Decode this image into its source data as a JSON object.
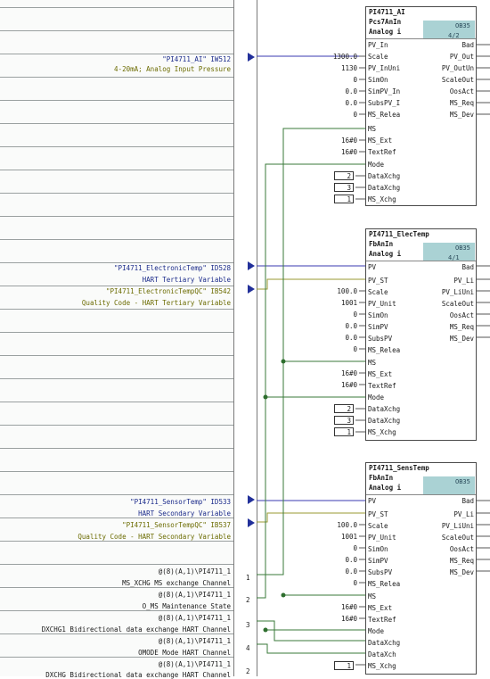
{
  "colors": {
    "blue_text": "#1a2a8a",
    "olive_text": "#6b6b00",
    "ob_fill": "#aad2d4",
    "wire_green": "#3a7a3a",
    "wire_olive": "#9a9a30",
    "wire_blue": "#3a3ab0"
  },
  "left_panel": {
    "params": [
      {
        "line1": "\"PI4711_AI\" IW512",
        "line2": "4-20mA; Analog Input Pressure",
        "c1": "blue",
        "c2": "olive"
      },
      {
        "line1": "\"PI4711_ElectronicTemp\" ID528",
        "line2": "HART Tertiary Variable",
        "c1": "blue",
        "c2": "blue"
      },
      {
        "line1": "\"PI4711_ElectronicTempQC\" IB542",
        "line2": "Quality Code - HART Tertiary Variable",
        "c1": "olive",
        "c2": "olive"
      },
      {
        "line1": "\"PI4711_SensorTemp\" ID533",
        "line2": "HART Secondary Variable",
        "c1": "blue",
        "c2": "blue"
      },
      {
        "line1": "\"PI4711_SensorTempQC\" IB537",
        "line2": "Quality Code - HART Secondary Variable",
        "c1": "olive",
        "c2": "olive"
      },
      {
        "line1": "@(8)(A,1)\\PI4711_1",
        "line2": "MS_XCHG MS exchange Channel",
        "c1": "blk",
        "c2": "blk"
      },
      {
        "line1": "@(8)(A,1)\\PI4711_1",
        "line2": "O_MS Maintenance State",
        "c1": "blk",
        "c2": "blk"
      },
      {
        "line1": "@(8)(A,1)\\PI4711_1",
        "line2": "DXCHG1 Bidirectional data exchange HART Channel",
        "c1": "blk",
        "c2": "blk"
      },
      {
        "line1": "@(8)(A,1)\\PI4711_1",
        "line2": "OMODE Mode HART Channel",
        "c1": "blk",
        "c2": "blk"
      },
      {
        "line1": "@(8)(A,1)\\PI4711_1",
        "line2": "DXCHG Bidirectional data exchange HART Channel",
        "c1": "blk",
        "c2": "blk"
      }
    ],
    "column_numbers": [
      "1",
      "2",
      "3",
      "4",
      "2"
    ]
  },
  "blocks": [
    {
      "name": "PI4711_AI",
      "type": "Pcs7AnIn",
      "sub": "Analog i",
      "ob": "OB35",
      "ob_frac": "4/2",
      "inputs": [
        {
          "pin": "PV_In",
          "val": ""
        },
        {
          "pin": "Scale",
          "val": "1300.0"
        },
        {
          "pin": "PV_InUni",
          "val": "1130"
        },
        {
          "pin": "SimOn",
          "val": "0"
        },
        {
          "pin": "SimPV_In",
          "val": "0.0"
        },
        {
          "pin": "SubsPV_I",
          "val": "0.0"
        },
        {
          "pin": "MS_Relea",
          "val": "0"
        },
        {
          "pin": "MS",
          "val": ""
        },
        {
          "pin": "MS_Ext",
          "val": "16#0"
        },
        {
          "pin": "TextRef",
          "val": "16#0"
        },
        {
          "pin": "Mode",
          "val": ""
        },
        {
          "pin": "DataXchg",
          "val": "2"
        },
        {
          "pin": "DataXchg",
          "val": "3"
        },
        {
          "pin": "MS_Xchg",
          "val": "1"
        }
      ],
      "outputs": [
        "Bad",
        "PV_Out",
        "PV_OutUn",
        "ScaleOut",
        "OosAct",
        "MS_Req",
        "MS_Dev"
      ]
    },
    {
      "name": "PI4711_ElecTemp",
      "type": "FbAnIn",
      "sub": "Analog i",
      "ob": "OB35",
      "ob_frac": "4/1",
      "inputs": [
        {
          "pin": "PV",
          "val": ""
        },
        {
          "pin": "PV_ST",
          "val": ""
        },
        {
          "pin": "Scale",
          "val": "100.0"
        },
        {
          "pin": "PV_Unit",
          "val": "1001"
        },
        {
          "pin": "SimOn",
          "val": "0"
        },
        {
          "pin": "SimPV",
          "val": "0.0"
        },
        {
          "pin": "SubsPV",
          "val": "0.0"
        },
        {
          "pin": "MS_Relea",
          "val": "0"
        },
        {
          "pin": "MS",
          "val": ""
        },
        {
          "pin": "MS_Ext",
          "val": "16#0"
        },
        {
          "pin": "TextRef",
          "val": "16#0"
        },
        {
          "pin": "Mode",
          "val": ""
        },
        {
          "pin": "DataXchg",
          "val": "2"
        },
        {
          "pin": "DataXchg",
          "val": "3"
        },
        {
          "pin": "MS_Xchg",
          "val": "1"
        }
      ],
      "outputs": [
        "Bad",
        "PV_Li",
        "PV_LiUni",
        "ScaleOut",
        "OosAct",
        "MS_Req",
        "MS_Dev"
      ]
    },
    {
      "name": "PI4711_SensTemp",
      "type": "FbAnIn",
      "sub": "Analog i",
      "ob": "OB35",
      "ob_frac": "",
      "inputs": [
        {
          "pin": "PV",
          "val": ""
        },
        {
          "pin": "PV_ST",
          "val": ""
        },
        {
          "pin": "Scale",
          "val": "100.0"
        },
        {
          "pin": "PV_Unit",
          "val": "1001"
        },
        {
          "pin": "SimOn",
          "val": "0"
        },
        {
          "pin": "SimPV",
          "val": "0.0"
        },
        {
          "pin": "SubsPV",
          "val": "0.0"
        },
        {
          "pin": "MS_Relea",
          "val": "0"
        },
        {
          "pin": "MS",
          "val": ""
        },
        {
          "pin": "MS_Ext",
          "val": "16#0"
        },
        {
          "pin": "TextRef",
          "val": "16#0"
        },
        {
          "pin": "Mode",
          "val": ""
        },
        {
          "pin": "DataXchg",
          "val": ""
        },
        {
          "pin": "DataXch",
          "val": ""
        },
        {
          "pin": "MS_Xchg",
          "val": "1"
        }
      ],
      "outputs": [
        "Bad",
        "PV_Li",
        "PV_LiUni",
        "ScaleOut",
        "OosAct",
        "MS_Req",
        "MS_Dev"
      ]
    }
  ]
}
